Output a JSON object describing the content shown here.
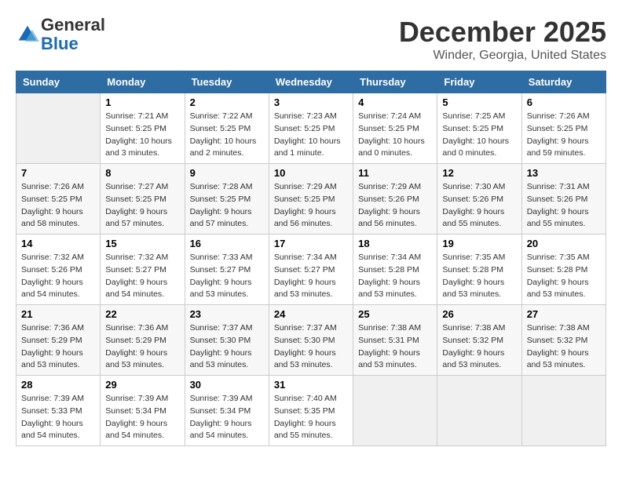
{
  "header": {
    "logo_general": "General",
    "logo_blue": "Blue",
    "month_title": "December 2025",
    "location": "Winder, Georgia, United States"
  },
  "columns": [
    "Sunday",
    "Monday",
    "Tuesday",
    "Wednesday",
    "Thursday",
    "Friday",
    "Saturday"
  ],
  "weeks": [
    [
      {
        "day": "",
        "info": ""
      },
      {
        "day": "1",
        "info": "Sunrise: 7:21 AM\nSunset: 5:25 PM\nDaylight: 10 hours\nand 3 minutes."
      },
      {
        "day": "2",
        "info": "Sunrise: 7:22 AM\nSunset: 5:25 PM\nDaylight: 10 hours\nand 2 minutes."
      },
      {
        "day": "3",
        "info": "Sunrise: 7:23 AM\nSunset: 5:25 PM\nDaylight: 10 hours\nand 1 minute."
      },
      {
        "day": "4",
        "info": "Sunrise: 7:24 AM\nSunset: 5:25 PM\nDaylight: 10 hours\nand 0 minutes."
      },
      {
        "day": "5",
        "info": "Sunrise: 7:25 AM\nSunset: 5:25 PM\nDaylight: 10 hours\nand 0 minutes."
      },
      {
        "day": "6",
        "info": "Sunrise: 7:26 AM\nSunset: 5:25 PM\nDaylight: 9 hours\nand 59 minutes."
      }
    ],
    [
      {
        "day": "7",
        "info": "Sunrise: 7:26 AM\nSunset: 5:25 PM\nDaylight: 9 hours\nand 58 minutes."
      },
      {
        "day": "8",
        "info": "Sunrise: 7:27 AM\nSunset: 5:25 PM\nDaylight: 9 hours\nand 57 minutes."
      },
      {
        "day": "9",
        "info": "Sunrise: 7:28 AM\nSunset: 5:25 PM\nDaylight: 9 hours\nand 57 minutes."
      },
      {
        "day": "10",
        "info": "Sunrise: 7:29 AM\nSunset: 5:25 PM\nDaylight: 9 hours\nand 56 minutes."
      },
      {
        "day": "11",
        "info": "Sunrise: 7:29 AM\nSunset: 5:26 PM\nDaylight: 9 hours\nand 56 minutes."
      },
      {
        "day": "12",
        "info": "Sunrise: 7:30 AM\nSunset: 5:26 PM\nDaylight: 9 hours\nand 55 minutes."
      },
      {
        "day": "13",
        "info": "Sunrise: 7:31 AM\nSunset: 5:26 PM\nDaylight: 9 hours\nand 55 minutes."
      }
    ],
    [
      {
        "day": "14",
        "info": "Sunrise: 7:32 AM\nSunset: 5:26 PM\nDaylight: 9 hours\nand 54 minutes."
      },
      {
        "day": "15",
        "info": "Sunrise: 7:32 AM\nSunset: 5:27 PM\nDaylight: 9 hours\nand 54 minutes."
      },
      {
        "day": "16",
        "info": "Sunrise: 7:33 AM\nSunset: 5:27 PM\nDaylight: 9 hours\nand 53 minutes."
      },
      {
        "day": "17",
        "info": "Sunrise: 7:34 AM\nSunset: 5:27 PM\nDaylight: 9 hours\nand 53 minutes."
      },
      {
        "day": "18",
        "info": "Sunrise: 7:34 AM\nSunset: 5:28 PM\nDaylight: 9 hours\nand 53 minutes."
      },
      {
        "day": "19",
        "info": "Sunrise: 7:35 AM\nSunset: 5:28 PM\nDaylight: 9 hours\nand 53 minutes."
      },
      {
        "day": "20",
        "info": "Sunrise: 7:35 AM\nSunset: 5:28 PM\nDaylight: 9 hours\nand 53 minutes."
      }
    ],
    [
      {
        "day": "21",
        "info": "Sunrise: 7:36 AM\nSunset: 5:29 PM\nDaylight: 9 hours\nand 53 minutes."
      },
      {
        "day": "22",
        "info": "Sunrise: 7:36 AM\nSunset: 5:29 PM\nDaylight: 9 hours\nand 53 minutes."
      },
      {
        "day": "23",
        "info": "Sunrise: 7:37 AM\nSunset: 5:30 PM\nDaylight: 9 hours\nand 53 minutes."
      },
      {
        "day": "24",
        "info": "Sunrise: 7:37 AM\nSunset: 5:30 PM\nDaylight: 9 hours\nand 53 minutes."
      },
      {
        "day": "25",
        "info": "Sunrise: 7:38 AM\nSunset: 5:31 PM\nDaylight: 9 hours\nand 53 minutes."
      },
      {
        "day": "26",
        "info": "Sunrise: 7:38 AM\nSunset: 5:32 PM\nDaylight: 9 hours\nand 53 minutes."
      },
      {
        "day": "27",
        "info": "Sunrise: 7:38 AM\nSunset: 5:32 PM\nDaylight: 9 hours\nand 53 minutes."
      }
    ],
    [
      {
        "day": "28",
        "info": "Sunrise: 7:39 AM\nSunset: 5:33 PM\nDaylight: 9 hours\nand 54 minutes."
      },
      {
        "day": "29",
        "info": "Sunrise: 7:39 AM\nSunset: 5:34 PM\nDaylight: 9 hours\nand 54 minutes."
      },
      {
        "day": "30",
        "info": "Sunrise: 7:39 AM\nSunset: 5:34 PM\nDaylight: 9 hours\nand 54 minutes."
      },
      {
        "day": "31",
        "info": "Sunrise: 7:40 AM\nSunset: 5:35 PM\nDaylight: 9 hours\nand 55 minutes."
      },
      {
        "day": "",
        "info": ""
      },
      {
        "day": "",
        "info": ""
      },
      {
        "day": "",
        "info": ""
      }
    ]
  ]
}
